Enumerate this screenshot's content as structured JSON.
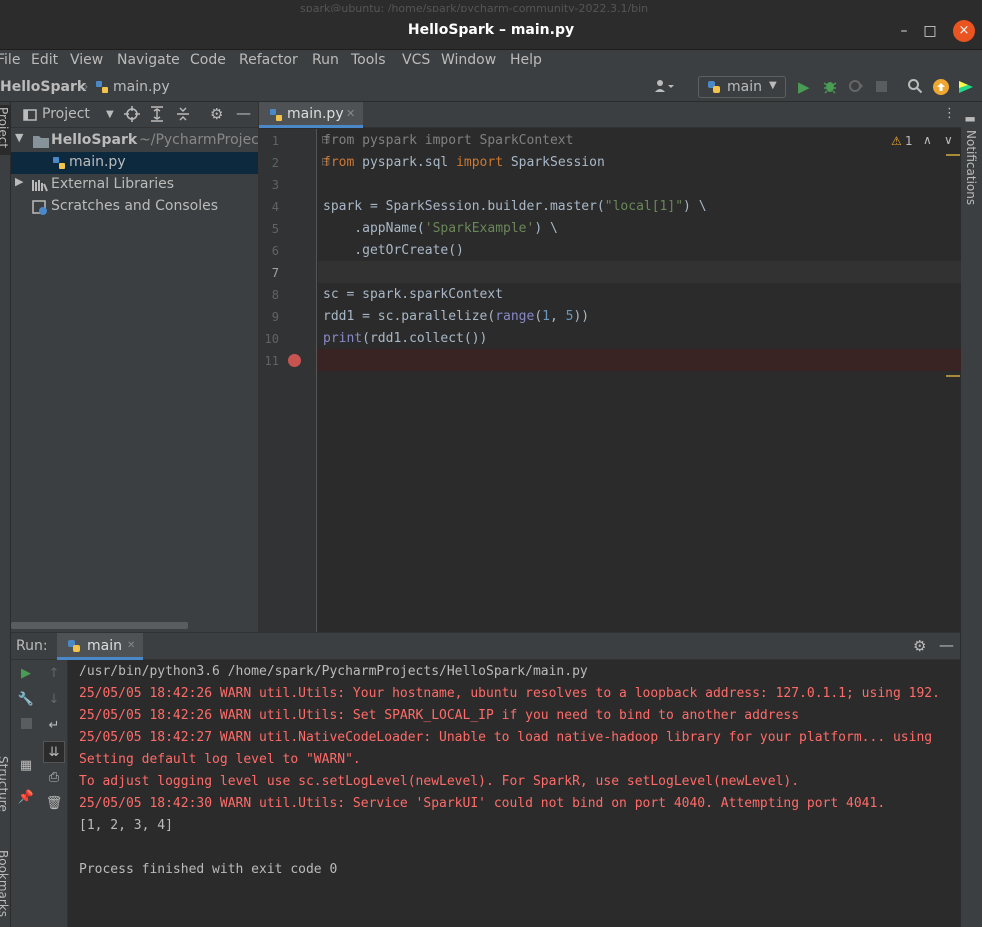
{
  "window": {
    "ghost_title": "spark@ubuntu: /home/spark/pycharm-community-2022.3.1/bin",
    "title": "HelloSpark – main.py",
    "minimize": "–",
    "maximize": "□",
    "close": "×"
  },
  "menu": [
    "File",
    "Edit",
    "View",
    "Navigate",
    "Code",
    "Refactor",
    "Run",
    "Tools",
    "VCS",
    "Window",
    "Help"
  ],
  "nav": {
    "project": "HelloSpark",
    "file": "main.py",
    "run_config": "main"
  },
  "project_panel": {
    "title": "Project",
    "items": [
      {
        "label": "HelloSpark",
        "path": "~/PycharmProjects/HelloSpark"
      },
      {
        "label": "main.py"
      },
      {
        "label": "External Libraries"
      },
      {
        "label": "Scratches and Consoles"
      }
    ]
  },
  "left_stripe": {
    "project": "Project",
    "structure": "Structure",
    "bookmarks": "Bookmarks"
  },
  "right_stripe": {
    "notifications": "Notifications"
  },
  "editor": {
    "tab": "main.py",
    "warnings": "1",
    "line_numbers": [
      "1",
      "2",
      "3",
      "4",
      "5",
      "6",
      "7",
      "8",
      "9",
      "10",
      "11"
    ]
  },
  "run": {
    "label": "Run:",
    "tab": "main",
    "output": [
      {
        "text": "/usr/bin/python3.6 /home/spark/PycharmProjects/HelloSpark/main.py",
        "type": "normal"
      },
      {
        "text": "25/05/05 18:42:26 WARN util.Utils: Your hostname, ubuntu resolves to a loopback address: 127.0.1.1; using 192.",
        "type": "warn"
      },
      {
        "text": "25/05/05 18:42:26 WARN util.Utils: Set SPARK_LOCAL_IP if you need to bind to another address",
        "type": "warn"
      },
      {
        "text": "25/05/05 18:42:27 WARN util.NativeCodeLoader: Unable to load native-hadoop library for your platform... using",
        "type": "warn"
      },
      {
        "text": "Setting default log level to \"WARN\".",
        "type": "warn"
      },
      {
        "text": "To adjust logging level use sc.setLogLevel(newLevel). For SparkR, use setLogLevel(newLevel).",
        "type": "warn"
      },
      {
        "text": "25/05/05 18:42:30 WARN util.Utils: Service 'SparkUI' could not bind on port 4040. Attempting port 4041.",
        "type": "warn"
      },
      {
        "text": "[1, 2, 3, 4]",
        "type": "normal"
      },
      {
        "text": "",
        "type": "normal"
      },
      {
        "text": "Process finished with exit code 0",
        "type": "normal"
      }
    ]
  },
  "colors": {
    "accent": "#4a88c7",
    "run_green": "#499c54",
    "breakpoint": "#c75450",
    "warn_text": "#ff6b68",
    "close_button": "#e95420"
  }
}
